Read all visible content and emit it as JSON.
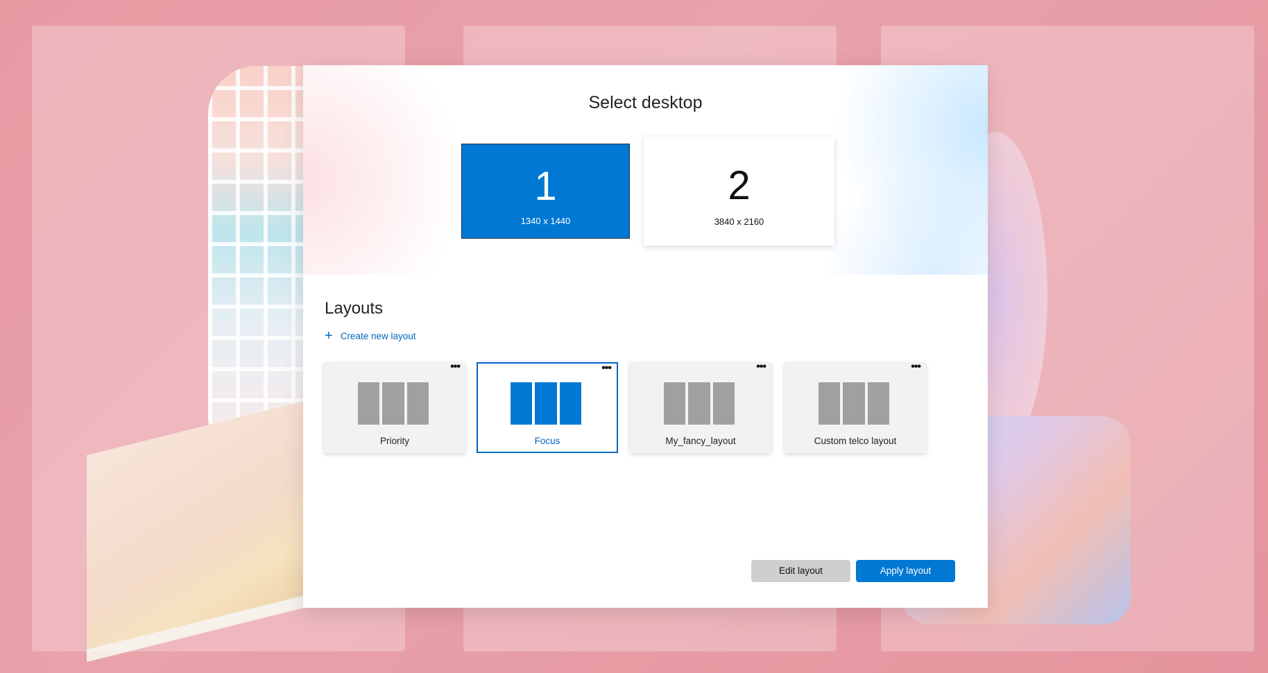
{
  "dialog": {
    "title": "Select desktop"
  },
  "monitors": [
    {
      "number": "1",
      "resolution": "1340 x 1440",
      "selected": true
    },
    {
      "number": "2",
      "resolution": "3840 x 2160",
      "selected": false
    }
  ],
  "layouts": {
    "heading": "Layouts",
    "create_label": "Create new layout",
    "create_icon": "plus-icon",
    "more_icon": "more-options-icon",
    "more_glyph": "•••",
    "items": [
      {
        "label": "Priority",
        "selected": false
      },
      {
        "label": "Focus",
        "selected": true
      },
      {
        "label": "My_fancy_layout",
        "selected": false
      },
      {
        "label": "Custom telco layout",
        "selected": false
      }
    ]
  },
  "actions": {
    "edit_label": "Edit layout",
    "apply_label": "Apply layout"
  },
  "colors": {
    "accent": "#0078d4",
    "link": "#0067c0",
    "zone_gray": "#a0a0a0",
    "secondary_button": "#cfcfcf"
  }
}
